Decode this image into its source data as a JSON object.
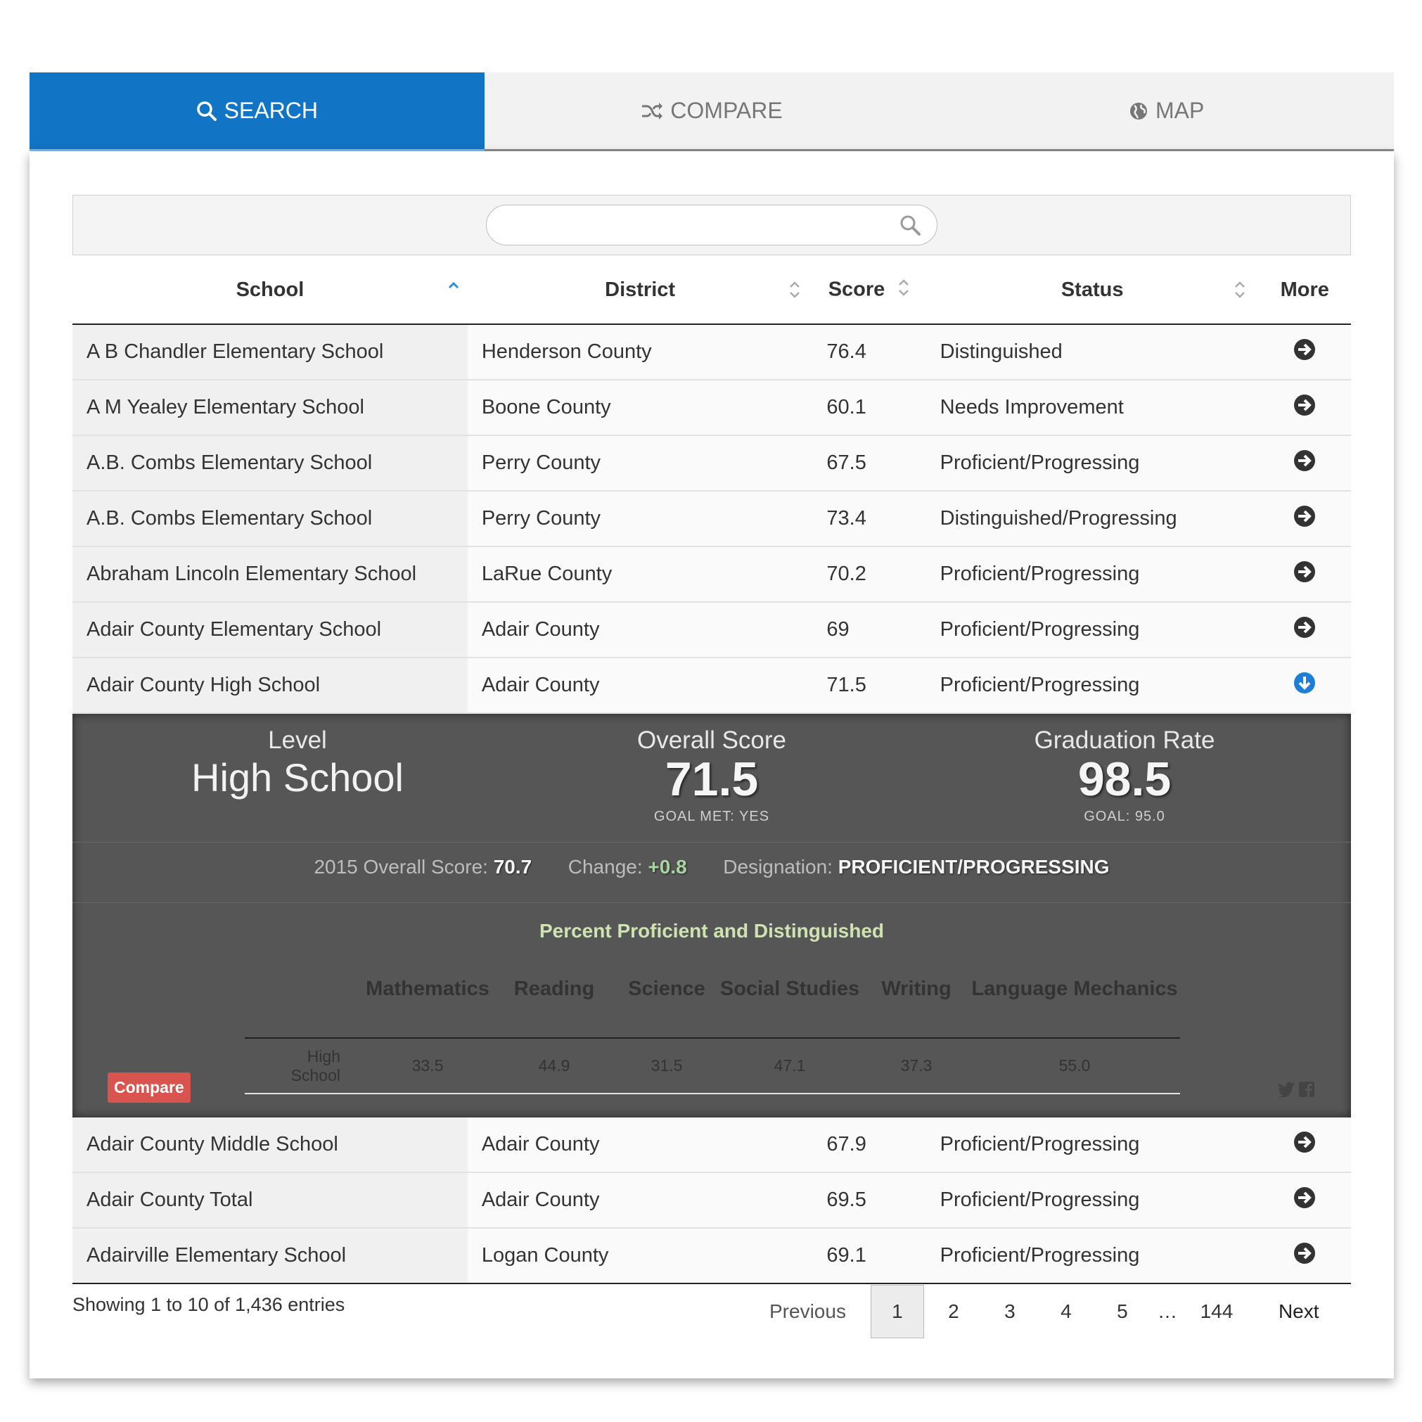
{
  "tabs": [
    {
      "label": "SEARCH",
      "icon": "search-icon",
      "active": true
    },
    {
      "label": "COMPARE",
      "icon": "shuffle-icon",
      "active": false
    },
    {
      "label": "MAP",
      "icon": "globe-icon",
      "active": false
    }
  ],
  "search": {
    "value": "",
    "placeholder": ""
  },
  "table": {
    "headers": {
      "school": "School",
      "district": "District",
      "score": "Score",
      "status": "Status",
      "more": "More"
    },
    "rows": [
      {
        "school": "A B Chandler Elementary School",
        "district": "Henderson County",
        "score": "76.4",
        "status": "Distinguished"
      },
      {
        "school": "A M Yealey Elementary School",
        "district": "Boone County",
        "score": "60.1",
        "status": "Needs Improvement"
      },
      {
        "school": "A.B. Combs Elementary School",
        "district": "Perry County",
        "score": "67.5",
        "status": "Proficient/Progressing"
      },
      {
        "school": "A.B. Combs Elementary School",
        "district": "Perry County",
        "score": "73.4",
        "status": "Distinguished/Progressing"
      },
      {
        "school": "Abraham Lincoln Elementary School",
        "district": "LaRue County",
        "score": "70.2",
        "status": "Proficient/Progressing"
      },
      {
        "school": "Adair County Elementary School",
        "district": "Adair County",
        "score": "69",
        "status": "Proficient/Progressing"
      },
      {
        "school": "Adair County High School",
        "district": "Adair County",
        "score": "71.5",
        "status": "Proficient/Progressing"
      },
      {
        "school": "Adair County Middle School",
        "district": "Adair County",
        "score": "67.9",
        "status": "Proficient/Progressing"
      },
      {
        "school": "Adair County Total",
        "district": "Adair County",
        "score": "69.5",
        "status": "Proficient/Progressing"
      },
      {
        "school": "Adairville Elementary School",
        "district": "Logan County",
        "score": "69.1",
        "status": "Proficient/Progressing"
      }
    ]
  },
  "detail": {
    "level_label": "Level",
    "level_value": "High School",
    "overall_label": "Overall Score",
    "overall_value": "71.5",
    "overall_goal": "GOAL MET: YES",
    "grad_label": "Graduation Rate",
    "grad_value": "98.5",
    "grad_goal": "GOAL: 95.0",
    "prev_label": "2015 Overall Score:",
    "prev_value": "70.7",
    "change_label": "Change:",
    "change_value": "+0.8",
    "designation_label": "Designation:",
    "designation_value": "PROFICIENT/PROGRESSING",
    "ppd_title": "Percent Proficient and Distinguished",
    "ppd_headers": [
      "Mathematics",
      "Reading",
      "Science",
      "Social Studies",
      "Writing",
      "Language Mechanics"
    ],
    "ppd_row_label": "High School",
    "ppd_values": [
      "33.5",
      "44.9",
      "31.5",
      "47.1",
      "37.3",
      "55.0"
    ],
    "compare_label": "Compare",
    "social_icons": [
      "twitter-icon",
      "facebook-icon"
    ]
  },
  "footer": {
    "info": "Showing 1 to 10 of 1,436 entries",
    "previous": "Previous",
    "pages": [
      "1",
      "2",
      "3",
      "4",
      "5"
    ],
    "ellipsis": "…",
    "last": "144",
    "next": "Next"
  },
  "colors": {
    "accent": "#1274c4",
    "detail_bg": "#565656",
    "compare": "#d9534f",
    "positive": "#a8d5a0",
    "ppd_title": "#cfe3b2"
  }
}
